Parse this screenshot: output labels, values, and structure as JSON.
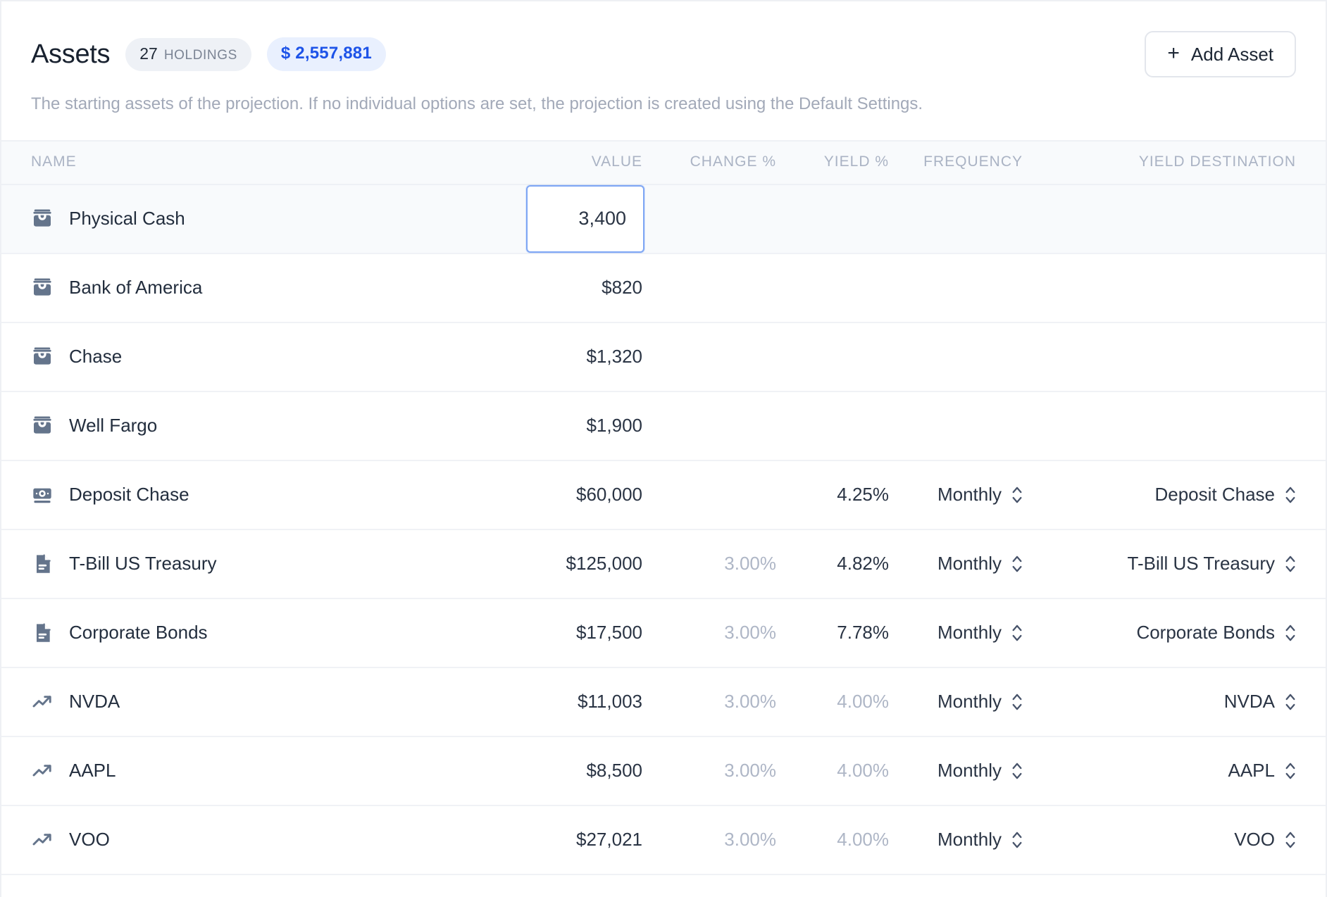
{
  "header": {
    "title": "Assets",
    "holdings_count": "27",
    "holdings_label": "HOLDINGS",
    "total_value": "$ 2,557,881",
    "add_button_plus": "+",
    "add_button_label": "Add Asset",
    "description": "The starting assets of the projection. If no individual options are set, the projection is created using the Default Settings."
  },
  "columns": {
    "name": "NAME",
    "value": "VALUE",
    "change": "CHANGE %",
    "yield": "YIELD %",
    "frequency": "FREQUENCY",
    "yield_destination": "YIELD DESTINATION"
  },
  "colors": {
    "accent_blue": "#1d53e8",
    "chip_count_bg": "#eef1f6",
    "chip_total_bg": "#e9f0fe",
    "focus_border": "#7ea6f4",
    "icon": "#64748b",
    "muted_text": "#aeb6c6",
    "header_text": "#aab3c4"
  },
  "rows": [
    {
      "icon": "wallet-icon",
      "name": "Physical Cash",
      "value": "3,400",
      "value_editing": true,
      "change": "",
      "yield": "",
      "yield_muted": false,
      "frequency": "",
      "yield_destination": "",
      "selected": true
    },
    {
      "icon": "wallet-icon",
      "name": "Bank of America",
      "value": "$820",
      "value_editing": false,
      "change": "",
      "yield": "",
      "yield_muted": false,
      "frequency": "",
      "yield_destination": "",
      "selected": false
    },
    {
      "icon": "wallet-icon",
      "name": "Chase",
      "value": "$1,320",
      "value_editing": false,
      "change": "",
      "yield": "",
      "yield_muted": false,
      "frequency": "",
      "yield_destination": "",
      "selected": false
    },
    {
      "icon": "wallet-icon",
      "name": "Well Fargo",
      "value": "$1,900",
      "value_editing": false,
      "change": "",
      "yield": "",
      "yield_muted": false,
      "frequency": "",
      "yield_destination": "",
      "selected": false
    },
    {
      "icon": "banknote-icon",
      "name": "Deposit Chase",
      "value": "$60,000",
      "value_editing": false,
      "change": "",
      "yield": "4.25%",
      "yield_muted": false,
      "frequency": "Monthly",
      "yield_destination": "Deposit Chase",
      "selected": false
    },
    {
      "icon": "document-icon",
      "name": "T-Bill US Treasury",
      "value": "$125,000",
      "value_editing": false,
      "change": "3.00%",
      "yield": "4.82%",
      "yield_muted": false,
      "frequency": "Monthly",
      "yield_destination": "T-Bill US Treasury",
      "selected": false
    },
    {
      "icon": "document-icon",
      "name": "Corporate Bonds",
      "value": "$17,500",
      "value_editing": false,
      "change": "3.00%",
      "yield": "7.78%",
      "yield_muted": false,
      "frequency": "Monthly",
      "yield_destination": "Corporate Bonds",
      "selected": false
    },
    {
      "icon": "trending-up-icon",
      "name": "NVDA",
      "value": "$11,003",
      "value_editing": false,
      "change": "3.00%",
      "yield": "4.00%",
      "yield_muted": true,
      "frequency": "Monthly",
      "yield_destination": "NVDA",
      "selected": false
    },
    {
      "icon": "trending-up-icon",
      "name": "AAPL",
      "value": "$8,500",
      "value_editing": false,
      "change": "3.00%",
      "yield": "4.00%",
      "yield_muted": true,
      "frequency": "Monthly",
      "yield_destination": "AAPL",
      "selected": false
    },
    {
      "icon": "trending-up-icon",
      "name": "VOO",
      "value": "$27,021",
      "value_editing": false,
      "change": "3.00%",
      "yield": "4.00%",
      "yield_muted": true,
      "frequency": "Monthly",
      "yield_destination": "VOO",
      "selected": false
    }
  ]
}
